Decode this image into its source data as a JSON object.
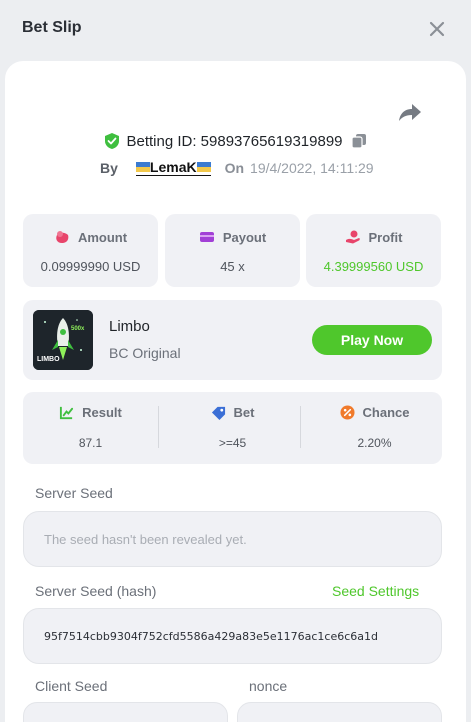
{
  "header": {
    "title": "Bet Slip",
    "close_icon": "close-icon"
  },
  "bet": {
    "id_text": "Betting ID: 59893765619319899",
    "by_label": "By",
    "username": "LemaK",
    "on_label": "On",
    "date": "19/4/2022, 14:11:29"
  },
  "stats": {
    "amount": {
      "label": "Amount",
      "value": "0.09999990 USD",
      "icon": "money-bag-icon"
    },
    "payout": {
      "label": "Payout",
      "value": "45 x",
      "icon": "wallet-icon"
    },
    "profit": {
      "label": "Profit",
      "value": "4.39999560 USD",
      "icon": "hand-coin-icon",
      "color": "#4fc72c"
    }
  },
  "game": {
    "name": "Limbo",
    "subtitle": "BC Original",
    "play_label": "Play Now",
    "thumb_text": "LIMBO",
    "thumb_badge": "500x"
  },
  "result": {
    "result": {
      "label": "Result",
      "value": "87.1"
    },
    "bet": {
      "label": "Bet",
      "value": ">=45"
    },
    "chance": {
      "label": "Chance",
      "value": "2.20%"
    }
  },
  "seeds": {
    "server_seed_label": "Server Seed",
    "server_seed_placeholder": "The seed hasn't been revealed yet.",
    "server_hash_label": "Server Seed (hash)",
    "seed_settings_label": "Seed Settings",
    "server_hash_value": "95f7514cbb9304f752cfd5586a429a83e5e1176ac1ce6c6a1d",
    "client_seed_label": "Client Seed",
    "nonce_label": "nonce"
  },
  "colors": {
    "accent": "#4fc72c",
    "background": "#eceef1",
    "panel": "#f0f1f5"
  }
}
